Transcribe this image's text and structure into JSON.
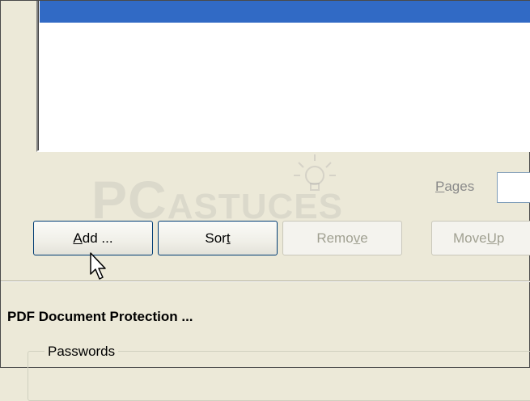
{
  "list": {
    "selected_row_color": "#316ac5"
  },
  "pages": {
    "label_prefix": "",
    "label_mnemonic": "P",
    "label_rest": "ages",
    "value": ""
  },
  "buttons": [
    {
      "pre": "",
      "mn": "A",
      "post": "dd ...",
      "enabled": true
    },
    {
      "pre": "Sor",
      "mn": "t",
      "post": "",
      "enabled": true
    },
    {
      "pre": "Remo",
      "mn": "v",
      "post": "e",
      "enabled": false
    },
    {
      "pre": "Move ",
      "mn": "U",
      "post": "p",
      "enabled": false
    }
  ],
  "section": {
    "title": "PDF Document Protection ..."
  },
  "passwords_group": {
    "label": "Passwords"
  },
  "watermark": {
    "text_big": "PC",
    "text_small": "ASTUCES"
  },
  "icons": {
    "cursor": "arrow-cursor-icon",
    "bulb": "lightbulb-watermark-icon"
  }
}
